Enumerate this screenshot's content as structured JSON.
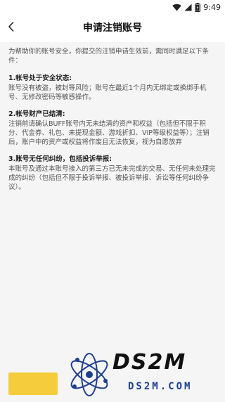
{
  "status_bar": {
    "time": "9:49",
    "icons": [
      "wifi-icon",
      "signal-icon",
      "battery-icon"
    ]
  },
  "nav": {
    "back_icon": "chevron-left-icon",
    "title": "申请注销账号"
  },
  "content": {
    "intro": "为帮助你的账号安全，你提交的注销申请生效前，需同时满足以下条件：",
    "sections": [
      {
        "heading": "1.帐号处于安全状态:",
        "body": "账号没有被盗，被封等风险；账号在最近1个月内无绑定或换绑手机号、无修改密码等敏感操作。"
      },
      {
        "heading": "2.帐号财产已结清:",
        "body": "注销前请确认BUFF账号内无未结清的资产和权益（包括但不限于积分、代金券、礼包、未提现金额、游戏折扣、VIP等级权益等）；注销后，账户中的资产或权益将作废且无法恢复，视为自愿放弃"
      },
      {
        "heading": "3.账号无任何纠纷，包括投诉举报:",
        "body": "本账号及通过本账号接入的第三方已无未完成的交易、无任何未处理完成的纠纷（包括但不限于投诉举报、被投诉举报、诉讼等任何纠纷争议）。"
      }
    ]
  },
  "submit_button": {
    "label": "",
    "color": "#f5cc3c"
  },
  "watermark": {
    "main": "DS2M",
    "sub": "DS2M.COM"
  },
  "colors": {
    "background": "#f5f5f5",
    "header": "#ffffff",
    "accent": "#f5cc3c"
  }
}
